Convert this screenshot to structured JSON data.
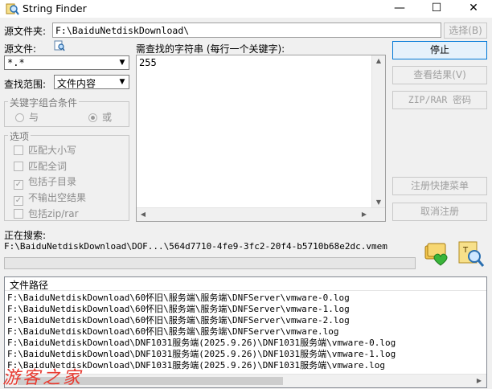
{
  "window": {
    "title": "String Finder",
    "minimize_glyph": "—",
    "maximize_glyph": "☐",
    "close_glyph": "✕"
  },
  "source_folder": {
    "label": "源文件夹:",
    "value": "F:\\BaiduNetdiskDownload\\",
    "browse_label": "选择(B)"
  },
  "source_files": {
    "label": "源文件:",
    "value": "*.*",
    "icon": "magnifier-document-icon"
  },
  "search_range": {
    "label": "查找范围:",
    "value": "文件内容"
  },
  "keywords": {
    "label": "需查找的字符串 (每行一个关键字):",
    "value": "255"
  },
  "combine": {
    "title": "关键字组合条件",
    "and_label": "与",
    "or_label": "或",
    "selected": "or"
  },
  "options": {
    "title": "选项",
    "items": [
      {
        "label": "匹配大小写",
        "checked": false
      },
      {
        "label": "匹配全词",
        "checked": false
      },
      {
        "label": "包括子目录",
        "checked": true
      },
      {
        "label": "不输出空结果",
        "checked": true
      },
      {
        "label": "包括zip/rar",
        "checked": false
      }
    ]
  },
  "buttons": {
    "stop": "停止",
    "view_results": "查看结果(V)",
    "zip_password": "ZIP/RAR 密码",
    "register_menu": "注册快捷菜单",
    "unregister": "取消注册"
  },
  "status": {
    "label": "正在搜索:",
    "path": "F:\\BaiduNetdiskDownload\\DOF...\\564d7710-4fe9-3fc2-20f4-b5710b68e2dc.vmem"
  },
  "results": {
    "column_header": "文件路径",
    "rows": [
      "F:\\BaiduNetdiskDownload\\60怀旧\\服务端\\服务端\\DNFServer\\vmware-0.log",
      "F:\\BaiduNetdiskDownload\\60怀旧\\服务端\\服务端\\DNFServer\\vmware-1.log",
      "F:\\BaiduNetdiskDownload\\60怀旧\\服务端\\服务端\\DNFServer\\vmware-2.log",
      "F:\\BaiduNetdiskDownload\\60怀旧\\服务端\\服务端\\DNFServer\\vmware.log",
      "F:\\BaiduNetdiskDownload\\DNF1031服务端(2025.9.26)\\DNF1031服务端\\vmware-0.log",
      "F:\\BaiduNetdiskDownload\\DNF1031服务端(2025.9.26)\\DNF1031服务端\\vmware-1.log",
      "F:\\BaiduNetdiskDownload\\DNF1031服务端(2025.9.26)\\DNF1031服务端\\vmware.log"
    ]
  },
  "watermark": "游客之家",
  "colors": {
    "accent": "#0078d7",
    "watermark": "#e8392f"
  }
}
